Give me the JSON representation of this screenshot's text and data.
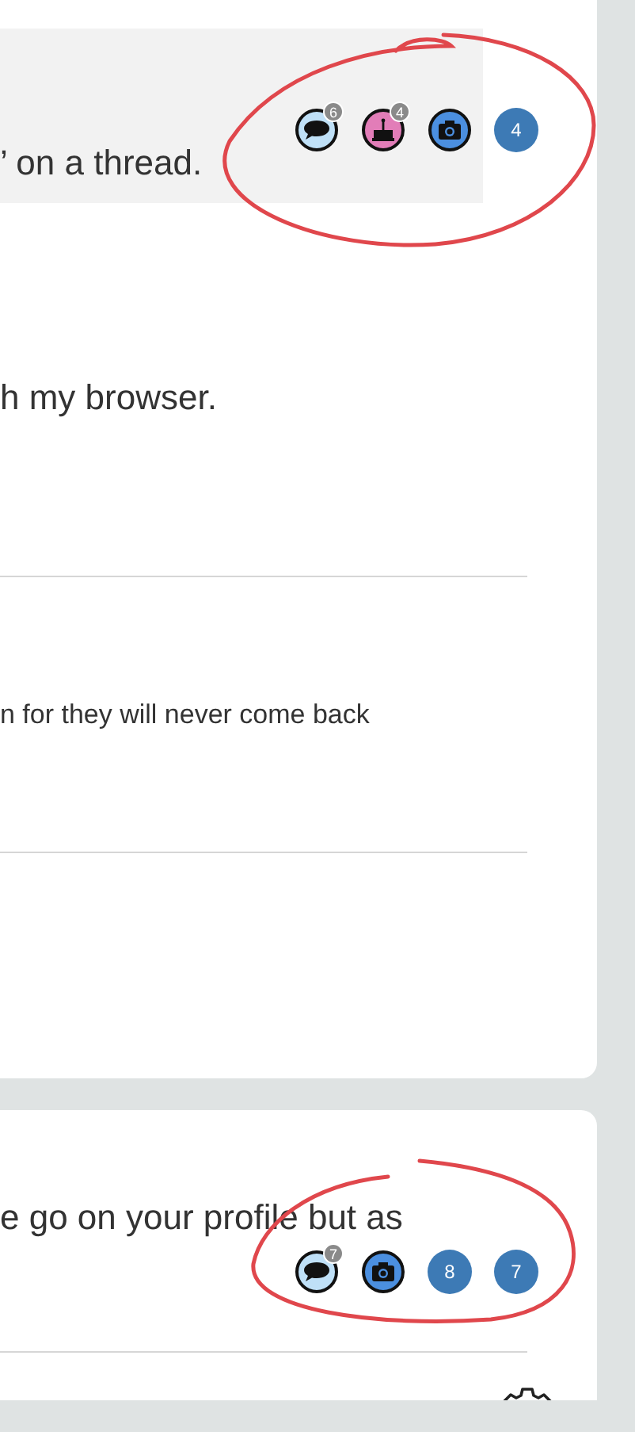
{
  "cards": [
    {
      "blocks": [
        {
          "kind": "quote",
          "text": "’ on a thread.",
          "badges": [
            {
              "kind": "comment",
              "count": "6"
            },
            {
              "kind": "cake",
              "count": "4"
            },
            {
              "kind": "camera"
            },
            {
              "kind": "number",
              "count": "4"
            }
          ]
        },
        {
          "kind": "text",
          "text": "h my browser.",
          "rule_below": true
        },
        {
          "kind": "small",
          "text": "n for they will never come back",
          "rule_below": true
        }
      ]
    },
    {
      "blocks": [
        {
          "kind": "text",
          "text": "e go on your profile but as",
          "rule_below": true,
          "badges": [
            {
              "kind": "comment",
              "count": "7"
            },
            {
              "kind": "camera"
            },
            {
              "kind": "number",
              "count": "8"
            },
            {
              "kind": "number",
              "count": "7"
            }
          ]
        },
        {
          "kind": "settings"
        }
      ]
    }
  ]
}
